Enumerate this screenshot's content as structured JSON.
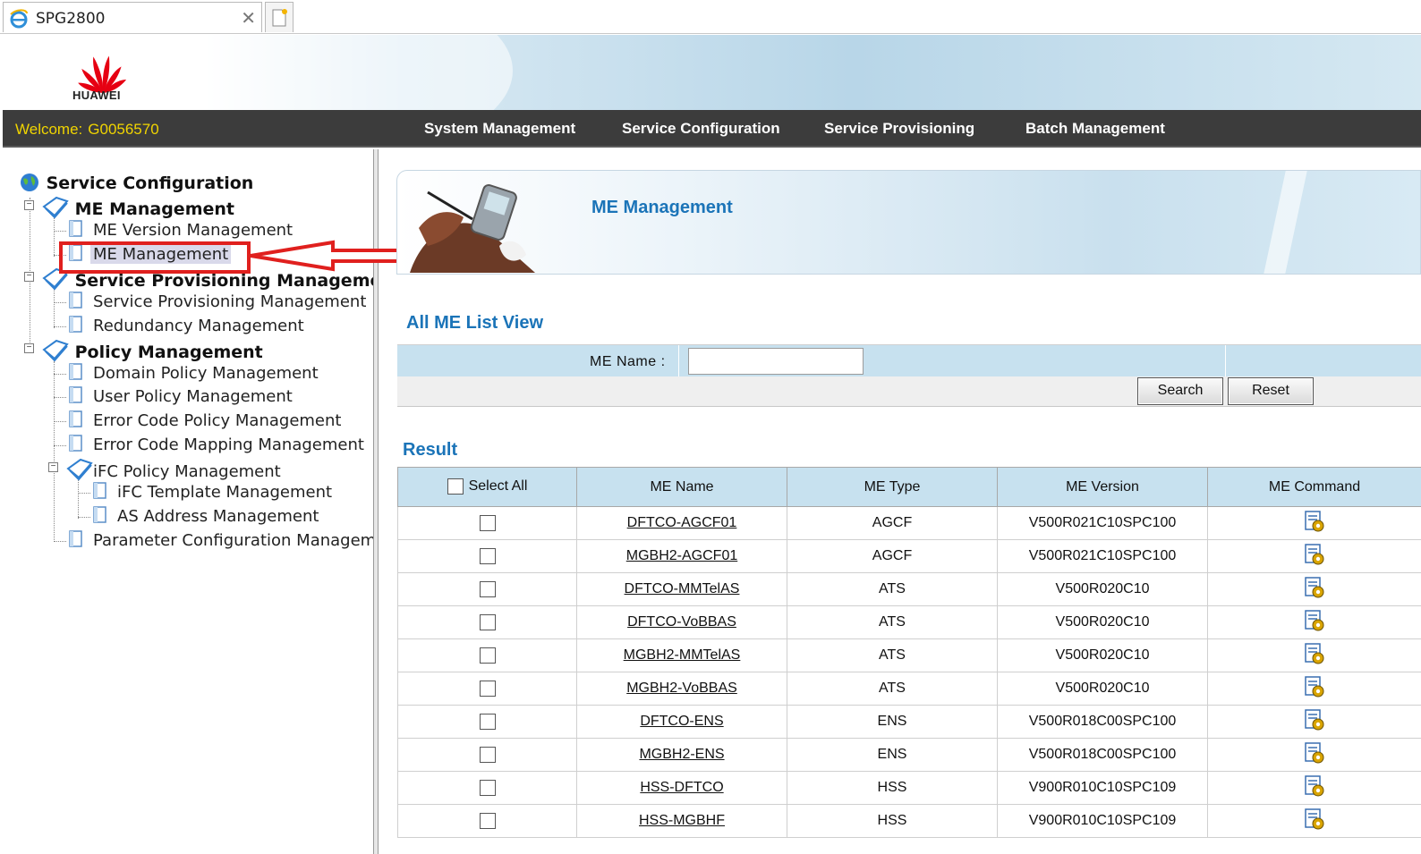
{
  "browser": {
    "tab_title": "SPG2800"
  },
  "banner": {
    "logo_text": "HUAWEI"
  },
  "topnav": {
    "welcome_label": "Welcome:",
    "user": "G0056570",
    "menu": [
      {
        "label": "System Management"
      },
      {
        "label": "Service Configuration"
      },
      {
        "label": "Service Provisioning"
      },
      {
        "label": "Batch Management"
      }
    ]
  },
  "tree": {
    "root": "Service Configuration",
    "me_management": "ME Management",
    "me_version_management": "ME Version Management",
    "me_management_leaf": "ME Management",
    "service_provisioning_management": "Service Provisioning Management",
    "service_provisioning_management_leaf": "Service Provisioning Management",
    "redundancy_management": "Redundancy Management",
    "policy_management": "Policy Management",
    "domain_policy_management": "Domain Policy Management",
    "user_policy_management": "User Policy Management",
    "error_code_policy_management": "Error Code Policy Management",
    "error_code_mapping_management": "Error Code Mapping Management",
    "ifc_policy_management": "iFC Policy Management",
    "ifc_template_management": "iFC Template Management",
    "as_address_management": "AS Address Management",
    "parameter_configuration_management": "Parameter Configuration Manageme"
  },
  "content": {
    "header_title": "ME Management",
    "list_view_title": "All ME List View",
    "form": {
      "me_name_label": "ME Name :",
      "me_name_value": "",
      "search_button": "Search",
      "reset_button": "Reset"
    },
    "result_title": "Result",
    "table": {
      "headers": {
        "select_all": "Select All",
        "me_name": "ME Name",
        "me_type": "ME Type",
        "me_version": "ME Version",
        "me_command": "ME Command"
      },
      "rows": [
        {
          "name": "DFTCO-AGCF01",
          "type": "AGCF",
          "version": "V500R021C10SPC100"
        },
        {
          "name": "MGBH2-AGCF01",
          "type": "AGCF",
          "version": "V500R021C10SPC100"
        },
        {
          "name": "DFTCO-MMTelAS",
          "type": "ATS",
          "version": "V500R020C10"
        },
        {
          "name": "DFTCO-VoBBAS",
          "type": "ATS",
          "version": "V500R020C10"
        },
        {
          "name": "MGBH2-MMTelAS",
          "type": "ATS",
          "version": "V500R020C10"
        },
        {
          "name": "MGBH2-VoBBAS",
          "type": "ATS",
          "version": "V500R020C10"
        },
        {
          "name": "DFTCO-ENS",
          "type": "ENS",
          "version": "V500R018C00SPC100"
        },
        {
          "name": "MGBH2-ENS",
          "type": "ENS",
          "version": "V500R018C00SPC100"
        },
        {
          "name": "HSS-DFTCO",
          "type": "HSS",
          "version": "V900R010C10SPC109"
        },
        {
          "name": "HSS-MGBHF",
          "type": "HSS",
          "version": "V900R010C10SPC109"
        }
      ]
    }
  },
  "colors": {
    "accent_blue": "#1b74b8",
    "nav_bg": "#3c3c3c",
    "welcome_yellow": "#f0d400",
    "table_header_bg": "#c7e1ef",
    "highlight_red": "#e0201e"
  },
  "icons": [
    "ie-browser-icon",
    "new-tab-icon",
    "huawei-logo",
    "globe-icon",
    "folder-book-icon",
    "page-icon",
    "me-command-icon",
    "red-arrow-annotation"
  ]
}
